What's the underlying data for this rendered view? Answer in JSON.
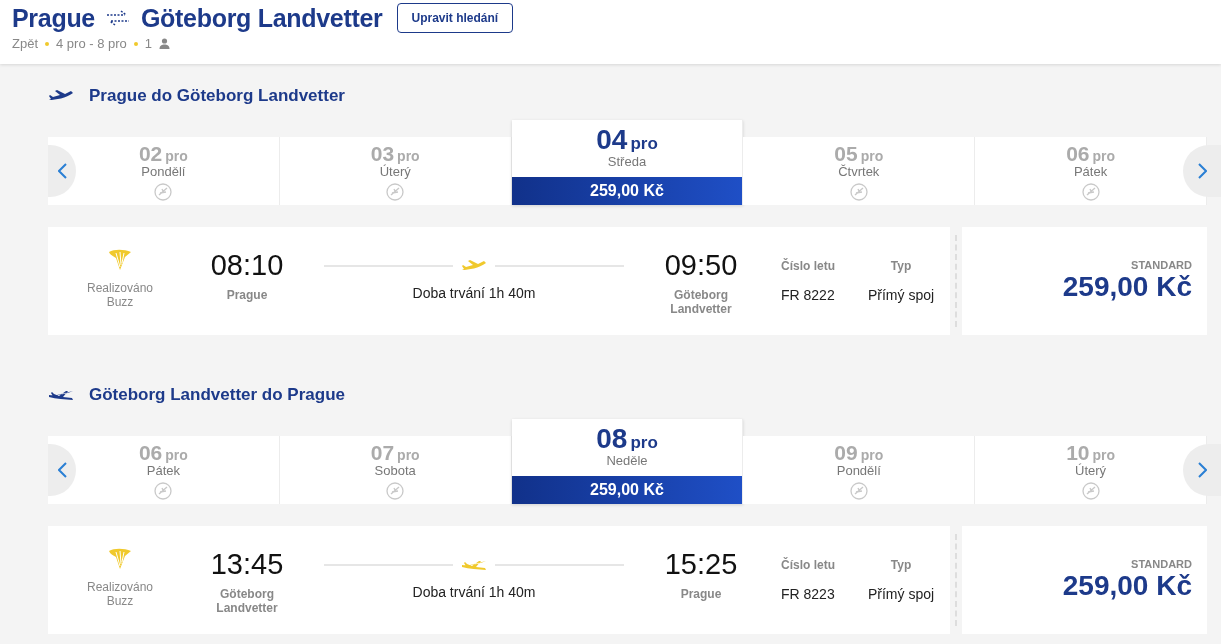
{
  "header": {
    "from": "Prague",
    "to": "Göteborg Landvetter",
    "edit_button": "Upravit hledání",
    "back": "Zpět",
    "dates": "4 pro - 8 pro",
    "passengers": "1"
  },
  "sections": [
    {
      "kind": "outbound",
      "title": "Prague do Göteborg Landvetter",
      "dates": [
        {
          "day": "02",
          "month": "pro",
          "weekday": "Pondělí",
          "selected": false
        },
        {
          "day": "03",
          "month": "pro",
          "weekday": "Úterý",
          "selected": false
        },
        {
          "day": "04",
          "month": "pro",
          "weekday": "Středa",
          "selected": true,
          "price": "259,00 Kč"
        },
        {
          "day": "05",
          "month": "pro",
          "weekday": "Čtvrtek",
          "selected": false
        },
        {
          "day": "06",
          "month": "pro",
          "weekday": "Pátek",
          "selected": false
        }
      ],
      "flight": {
        "operator": "Realizováno Buzz",
        "depart_time": "08:10",
        "depart_city": "Prague",
        "duration": "Doba trvání 1h 40m",
        "arrive_time": "09:50",
        "arrive_city": "Göteborg Landvetter",
        "flight_no_label": "Číslo letu",
        "flight_no": "FR 8222",
        "type_label": "Typ",
        "type": "Přímý spoj",
        "fare": "STANDARD",
        "price": "259,00 Kč"
      }
    },
    {
      "kind": "inbound",
      "title": "Göteborg Landvetter do Prague",
      "dates": [
        {
          "day": "06",
          "month": "pro",
          "weekday": "Pátek",
          "selected": false
        },
        {
          "day": "07",
          "month": "pro",
          "weekday": "Sobota",
          "selected": false
        },
        {
          "day": "08",
          "month": "pro",
          "weekday": "Neděle",
          "selected": true,
          "price": "259,00 Kč"
        },
        {
          "day": "09",
          "month": "pro",
          "weekday": "Pondělí",
          "selected": false
        },
        {
          "day": "10",
          "month": "pro",
          "weekday": "Úterý",
          "selected": false
        }
      ],
      "flight": {
        "operator": "Realizováno Buzz",
        "depart_time": "13:45",
        "depart_city": "Göteborg Landvetter",
        "duration": "Doba trvání 1h 40m",
        "arrive_time": "15:25",
        "arrive_city": "Prague",
        "flight_no_label": "Číslo letu",
        "flight_no": "FR 8223",
        "type_label": "Typ",
        "type": "Přímý spoj",
        "fare": "STANDARD",
        "price": "259,00 Kč"
      }
    }
  ]
}
